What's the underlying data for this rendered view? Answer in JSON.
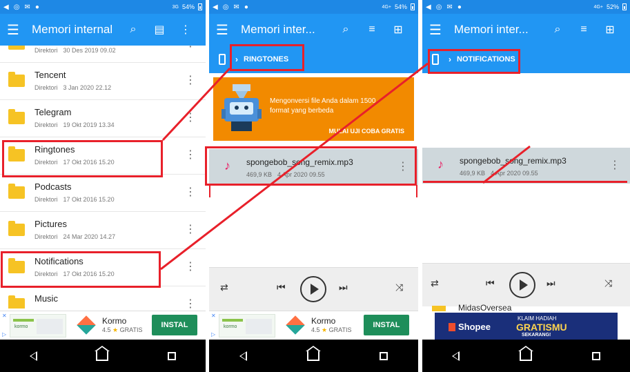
{
  "status_bar": {
    "left": {
      "network": "3G",
      "battery": "54%"
    },
    "middle": {
      "network": "4G+",
      "battery": "54%"
    },
    "right": {
      "network": "4G+",
      "battery": "52%"
    }
  },
  "icons": {
    "menu": "☰",
    "search": "⌕",
    "clipboard": "▤",
    "more": "⋮",
    "sort": "≡",
    "add-folder": "⊞",
    "volume": "◀",
    "whatsapp": "◎",
    "mail": "✉",
    "record": "●",
    "music-note": "♪",
    "repeat": "⇄",
    "prev": "⏮",
    "next": "⏭",
    "shuffle": "⤨"
  },
  "left": {
    "app_title": "Memori internal",
    "folders": [
      {
        "name": "",
        "label": "Direktori",
        "date": "30 Des 2019 09.02"
      },
      {
        "name": "Tencent",
        "label": "Direktori",
        "date": "3 Jan 2020 22.12"
      },
      {
        "name": "Telegram",
        "label": "Direktori",
        "date": "19 Okt 2019 13.34"
      },
      {
        "name": "Ringtones",
        "label": "Direktori",
        "date": "17 Okt 2016 15.20"
      },
      {
        "name": "Podcasts",
        "label": "Direktori",
        "date": "17 Okt 2016 15.20"
      },
      {
        "name": "Pictures",
        "label": "Direktori",
        "date": "24 Mar 2020 14.27"
      },
      {
        "name": "Notifications",
        "label": "Direktori",
        "date": "17 Okt 2016 15.20"
      },
      {
        "name": "Music",
        "label": "",
        "date": ""
      }
    ],
    "ad": {
      "brand": "Kormo",
      "rating": "4.5",
      "free": "GRATIS",
      "install": "INSTAL",
      "thumb_label": "kormo"
    }
  },
  "middle": {
    "app_title": "Memori inter...",
    "breadcrumb": "RINGTONES",
    "promo": {
      "text": "Mengonversi file Anda dalam 1500 format yang berbeda",
      "cta": "MULAI UJI COBA GRATIS"
    },
    "song": {
      "name": "spongebob_song_remix.mp3",
      "size": "469,9 KB",
      "date": "4 Apr 2020 09.55"
    },
    "ad": {
      "brand": "Kormo",
      "rating": "4.5",
      "free": "GRATIS",
      "install": "INSTAL",
      "thumb_label": "kormo"
    }
  },
  "right": {
    "app_title": "Memori inter...",
    "breadcrumb": "NOTIFICATIONS",
    "song": {
      "name": "spongebob_song_remix.mp3",
      "size": "469,9 KB",
      "date": "4 Apr 2020 09.55"
    },
    "peek_folder": "MidasOversea",
    "shopee": {
      "brand": "Shopee",
      "line1": "KLAIM HADIAH",
      "line2": "GRATISMU",
      "line3": "SEKARANG!"
    }
  },
  "colors": {
    "primary": "#2196f3",
    "status": "#1e88e5",
    "highlight": "#e8202a",
    "promo": "#f28a00",
    "folder": "#f6c324",
    "install": "#1e8e5a"
  }
}
